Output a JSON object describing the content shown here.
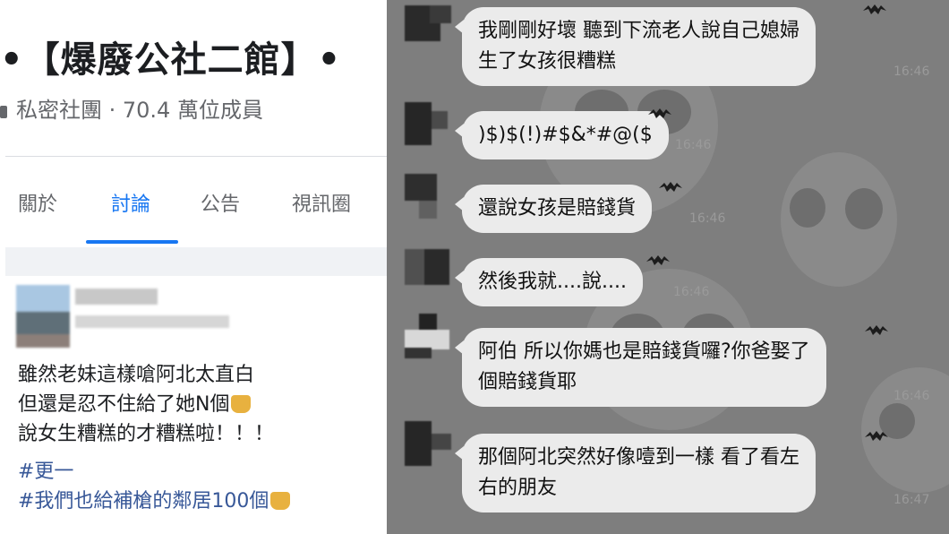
{
  "group": {
    "title": "•【爆廢公社二館】•",
    "subtitle": "私密社團 · 70.4 萬位成員"
  },
  "tabs": [
    {
      "label": "關於"
    },
    {
      "label": "討論"
    },
    {
      "label": "公告"
    },
    {
      "label": "視訊圈"
    }
  ],
  "post": {
    "lines": [
      "雖然老妹這樣嗆阿北太直白",
      "但還是忍不住給了她N個",
      "說女生糟糕的才糟糕啦！！！"
    ],
    "hashtags": [
      "#更一",
      "#我們也給補槍的鄰居100個"
    ]
  },
  "chat": {
    "messages": [
      {
        "lines": [
          "我剛剛好壞 聽到下流老人說自己媳婦",
          "生了女孩很糟糕"
        ],
        "time": "16:46"
      },
      {
        "lines": [
          ")$)$(!)#$&*#@($"
        ],
        "time": "16:46"
      },
      {
        "lines": [
          "還說女孩是賠錢貨"
        ],
        "time": "16:46"
      },
      {
        "lines": [
          "然後我就....說...."
        ],
        "time": "16:46"
      },
      {
        "lines": [
          "阿伯 所以你媽也是賠錢貨囉?你爸娶了",
          "個賠錢貨耶"
        ],
        "time": "16:46"
      },
      {
        "lines": [
          "那個阿北突然好像噎到一樣 看了看左",
          "右的朋友"
        ],
        "time": "16:47"
      }
    ]
  },
  "colors": {
    "facebook_blue": "#1877f2",
    "chat_background": "#7e7e7e",
    "bubble": "#ebebeb",
    "hashtag": "#385898"
  }
}
